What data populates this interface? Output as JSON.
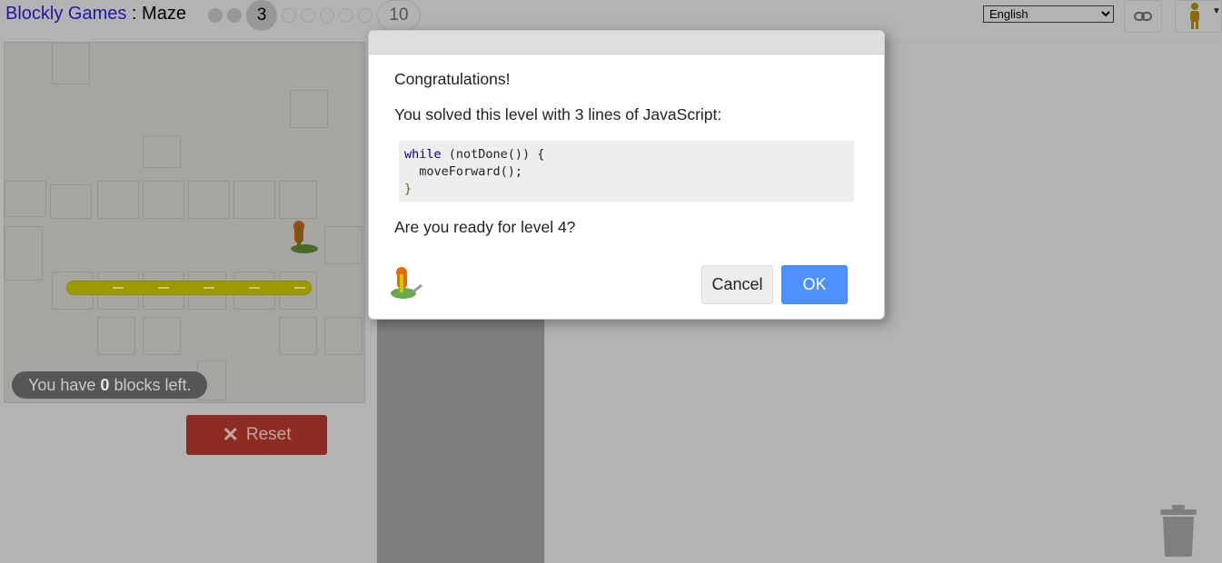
{
  "header": {
    "app_title": "Blockly Games",
    "separator": " : ",
    "game_name": "Maze",
    "levels": [
      {
        "label": "",
        "state": "solved"
      },
      {
        "label": "",
        "state": "solved"
      },
      {
        "label": "3",
        "state": "current"
      },
      {
        "label": "",
        "state": "empty"
      },
      {
        "label": "",
        "state": "empty"
      },
      {
        "label": "",
        "state": "empty"
      },
      {
        "label": "",
        "state": "empty"
      },
      {
        "label": "",
        "state": "empty"
      },
      {
        "label": "10",
        "state": "last"
      }
    ],
    "language": "English",
    "link_icon": "link-icon",
    "pegman_icon": "pegman-icon"
  },
  "maze": {
    "blocks_left_prefix": "You have ",
    "blocks_left_count": "0",
    "blocks_left_suffix": " blocks left."
  },
  "controls": {
    "reset_label": "Reset"
  },
  "dialog": {
    "title": "Congratulations!",
    "message": "You solved this level with 3 lines of JavaScript:",
    "code_lines": [
      {
        "kw": "while",
        "rest": " (notDone()) {"
      },
      {
        "kw": "",
        "rest": "  moveForward();"
      },
      {
        "kw": "",
        "rest": "}"
      }
    ],
    "question": "Are you ready for level 4?",
    "cancel_label": "Cancel",
    "ok_label": "OK"
  },
  "colors": {
    "ok_button": "#4d90fe",
    "reset_button": "#8c2c22",
    "overlay": "#b3b3b3"
  }
}
